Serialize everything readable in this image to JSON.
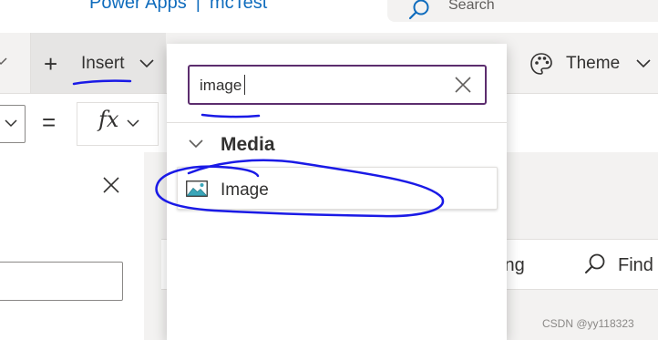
{
  "header": {
    "app_name": "Power Apps",
    "separator": "|",
    "app_file": "mcTest",
    "search_placeholder": "Search"
  },
  "command_bar": {
    "insert_label": "Insert",
    "theme_label": "Theme"
  },
  "formula_bar": {
    "equals": "=",
    "fx_label": "fx"
  },
  "insert_flyout": {
    "search_value": "image",
    "group_label": "Media",
    "items": [
      {
        "label": "Image",
        "icon": "image-icon"
      }
    ]
  },
  "right_toolbar": {
    "setting_label": "tting",
    "find_label": "Find"
  },
  "watermark": "CSDN @yy118323",
  "colors": {
    "brand_blue": "#0f6cbd",
    "search_border": "#5c2d6e",
    "annotation_ink": "#1a1ae6"
  }
}
